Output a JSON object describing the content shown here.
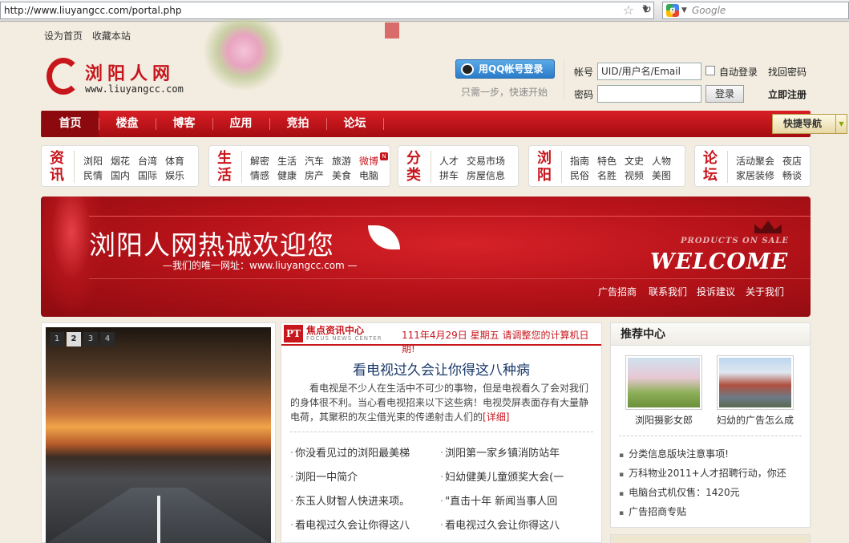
{
  "browser": {
    "url": "http://www.liuyangcc.com/portal.php",
    "search_placeholder": "Google"
  },
  "toplinks": [
    "设为首页",
    "收藏本站"
  ],
  "logo": {
    "name": "浏阳人网",
    "domain": "www.liuyangcc.com"
  },
  "login": {
    "qq_button": "用QQ帐号登录",
    "qq_sub": "只需一步，快速开始",
    "account_label": "帐号",
    "account_placeholder": "UID/用户名/Email",
    "auto_login": "自动登录",
    "find_password": "找回密码",
    "password_label": "密码",
    "login_button": "登录",
    "register": "立即注册"
  },
  "nav": {
    "items": [
      "首页",
      "楼盘",
      "博客",
      "应用",
      "竞拍",
      "论坛"
    ],
    "active": "首页",
    "quick_nav": "快捷导航"
  },
  "categories": [
    {
      "big": "资讯",
      "links": [
        "浏阳",
        "烟花",
        "台湾",
        "体育",
        "民情",
        "国内",
        "国际",
        "娱乐"
      ]
    },
    {
      "big": "生活",
      "links": [
        "解密",
        "生活",
        "汽车",
        "旅游",
        "微博",
        "情感",
        "健康",
        "房产",
        "美食",
        "电脑"
      ]
    },
    {
      "big": "分类",
      "links": [
        "人才",
        "交易市场",
        "拼车",
        "房屋信息"
      ]
    },
    {
      "big": "浏阳",
      "links": [
        "指南",
        "特色",
        "文史",
        "人物",
        "民俗",
        "名胜",
        "视频",
        "美图"
      ]
    },
    {
      "big": "论坛",
      "links": [
        "活动聚会",
        "夜店",
        "家居装修",
        "畅谈"
      ]
    }
  ],
  "banner": {
    "title": "浏阳人网热诚欢迎您",
    "subtitle": "—我们的唯一网址：www.liuyangcc.com —",
    "products": "PRODUCTS ON SALE",
    "welcome": "WELCOME",
    "links": [
      "广告招商",
      "联系我们",
      "投诉建议",
      "关于我们"
    ]
  },
  "slider": {
    "pages": [
      "1",
      "2",
      "3",
      "4"
    ],
    "active": "2"
  },
  "news": {
    "badge": "PT",
    "section": "焦点资讯中心",
    "section_en": "FOCUS NEWS CENTER",
    "date": "111年4月29日 星期五 请调整您的计算机日期!",
    "headline": "看电视过久会让你得这八种病",
    "summary": "看电视是不少人在生活中不可少的事物，但是电视看久了会对我们的身体很不利。当心看电视招来以下这些病！电视荧屏表面存有大量静电荷，其聚积的灰尘借光束的传递射击人们的",
    "more": "[详细]",
    "items": [
      "你没看见过的浏阳最美梯",
      "浏阳第一家乡镇消防站年",
      "浏阳一中简介",
      "妇幼健美儿童颁奖大会(一",
      "东玉人财智人快进来项。",
      "\"直击十年 新闻当事人回",
      "看电视过久会让你得这八",
      "看电视过久会让你得这八"
    ]
  },
  "recommend": {
    "title": "推荐中心",
    "thumbs": [
      {
        "caption": "浏阳摄影女郎"
      },
      {
        "caption": "妇幼的广告怎么成"
      }
    ],
    "items": [
      "分类信息版块注意事项!",
      "万科物业2011+人才招聘行动，你还",
      "电脑台式机仅售：1420元",
      "广告招商专贴"
    ]
  }
}
